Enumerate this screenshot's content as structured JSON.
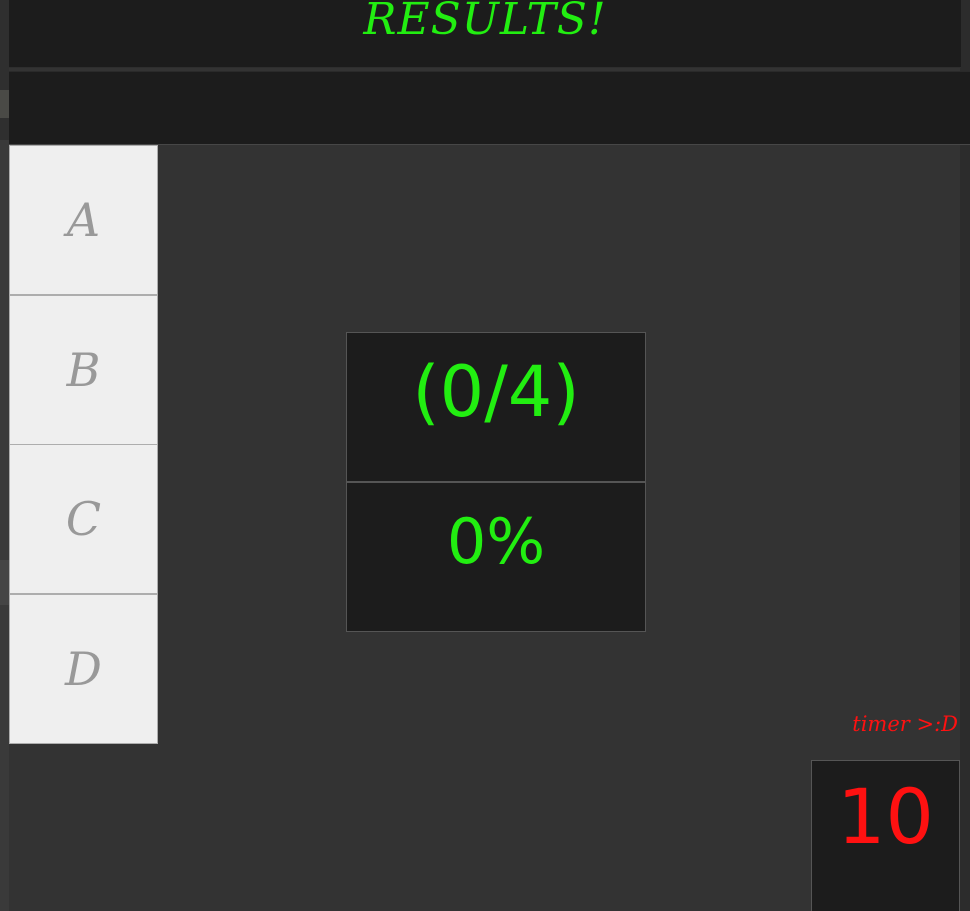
{
  "header": {
    "title": "RESULTS!"
  },
  "answers": [
    {
      "label": "A"
    },
    {
      "label": "B"
    },
    {
      "label": "C"
    },
    {
      "label": "D"
    }
  ],
  "score": {
    "fraction": "(0/4)",
    "percent": "0%"
  },
  "timer": {
    "label": "timer >:D",
    "value": "10"
  },
  "colors": {
    "accent_green": "#22ee11",
    "timer_red": "#ff1111",
    "panel_dark": "#1c1c1c",
    "background": "#333333",
    "button_light": "#efefef"
  }
}
